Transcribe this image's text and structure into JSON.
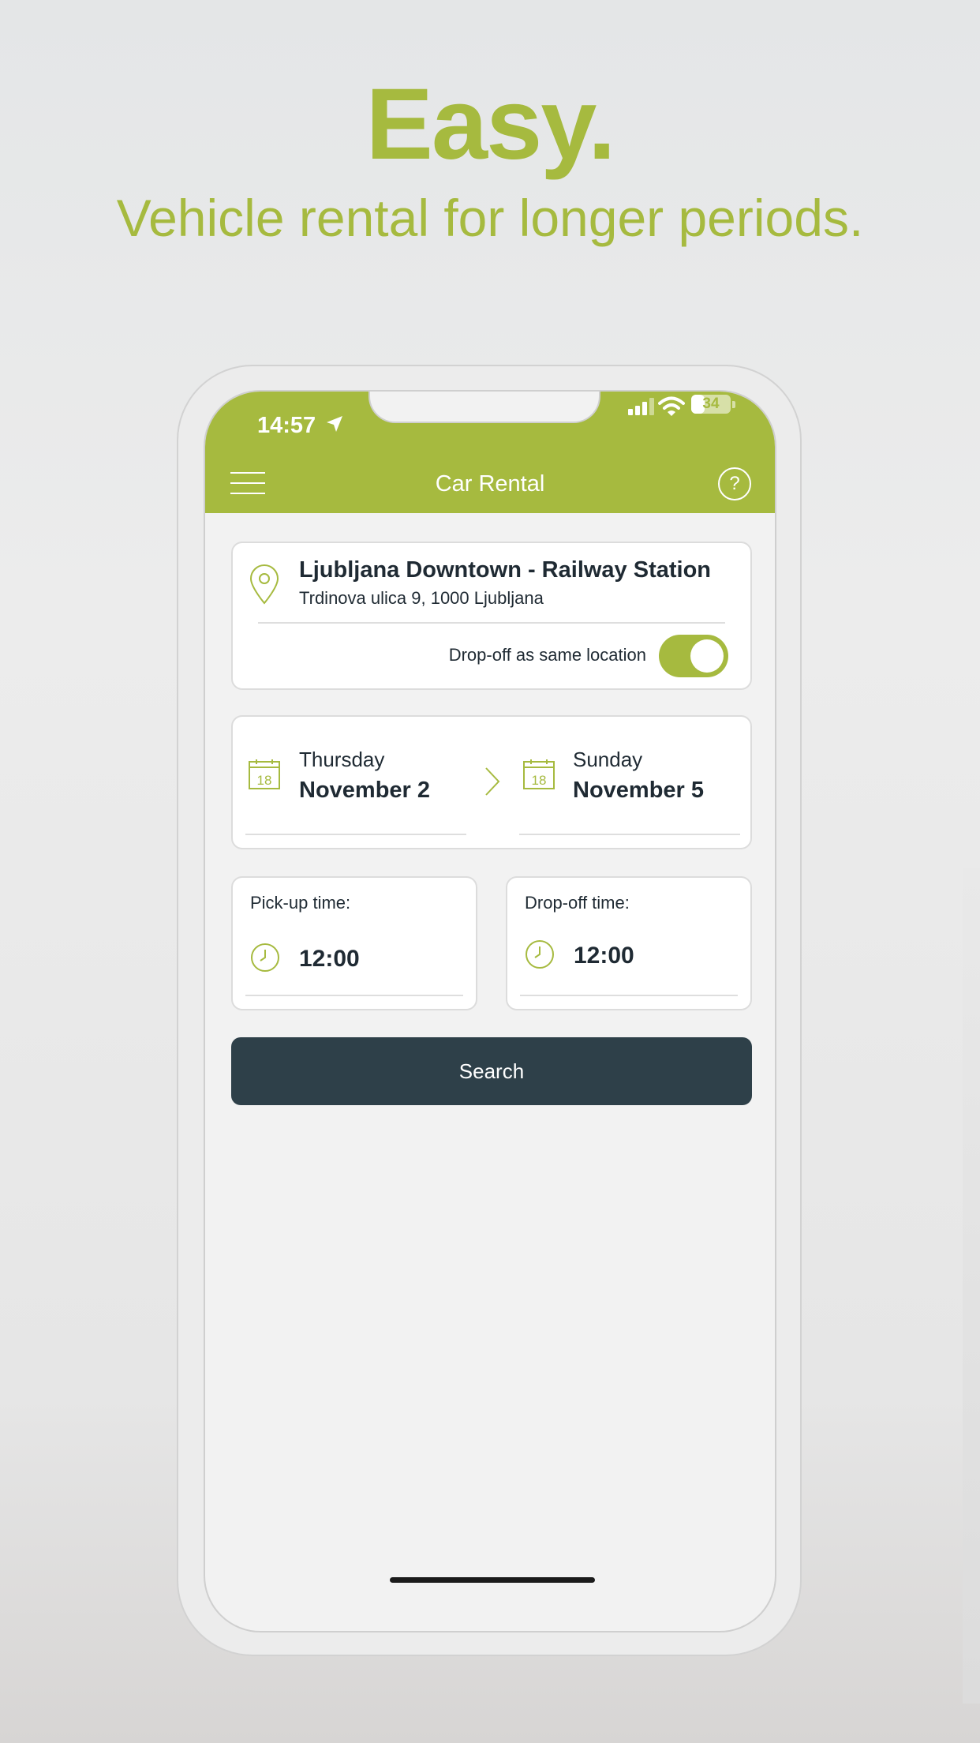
{
  "promo": {
    "headline": "Easy.",
    "subline": "Vehicle rental for longer periods."
  },
  "status_bar": {
    "time": "14:57",
    "battery": "34",
    "battery_level": 0.34
  },
  "app_bar": {
    "title": "Car Rental",
    "help_label": "?"
  },
  "location": {
    "name": "Ljubljana Downtown - Railway Station",
    "address": "Trdinova ulica 9, 1000 Ljubljana",
    "same_dropoff_label": "Drop-off as same location",
    "same_dropoff_enabled": true
  },
  "dates": {
    "calendar_icon_number": "18",
    "pickup": {
      "day": "Thursday",
      "date": "November 2"
    },
    "dropoff": {
      "day": "Sunday",
      "date": "November 5"
    }
  },
  "times": {
    "pickup": {
      "label": "Pick-up time:",
      "value": "12:00"
    },
    "dropoff": {
      "label": "Drop-off time:",
      "value": "12:00"
    }
  },
  "search": {
    "label": "Search"
  },
  "colors": {
    "accent": "#a6ba3f",
    "button_dark": "#2e4049",
    "text_dark": "#1f2a33"
  }
}
